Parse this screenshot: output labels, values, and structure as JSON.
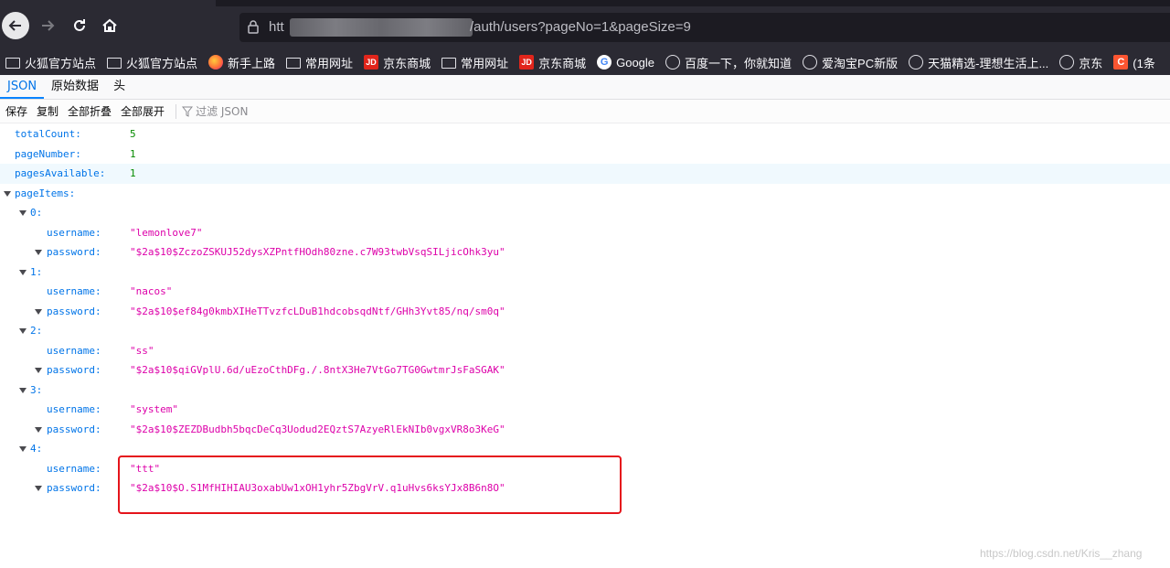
{
  "browser": {
    "url_prefix": "htt",
    "url_suffix": "/auth/users?pageNo=1&pageSize=9",
    "bookmarks": [
      {
        "label": "火狐官方站点",
        "icon": "folder-icon"
      },
      {
        "label": "火狐官方站点",
        "icon": "folder-icon"
      },
      {
        "label": "新手上路",
        "icon": "firefox-icon"
      },
      {
        "label": "常用网址",
        "icon": "folder-icon"
      },
      {
        "label": "京东商城",
        "icon": "jd-icon"
      },
      {
        "label": "常用网址",
        "icon": "folder-icon"
      },
      {
        "label": "京东商城",
        "icon": "jd-icon"
      },
      {
        "label": "Google",
        "icon": "google-icon"
      },
      {
        "label": "百度一下，你就知道",
        "icon": "globe-icon"
      },
      {
        "label": "爱淘宝PC新版",
        "icon": "globe-icon"
      },
      {
        "label": "天猫精选-理想生活上...",
        "icon": "globe-icon"
      },
      {
        "label": "京东",
        "icon": "globe-icon"
      },
      {
        "label": "(1条",
        "icon": "csdn-icon"
      }
    ]
  },
  "viewer": {
    "tabs": [
      "JSON",
      "原始数据",
      "头"
    ],
    "active_tab": "JSON",
    "toolbar": {
      "save": "保存",
      "copy": "复制",
      "collapse_all": "全部折叠",
      "expand_all": "全部展开",
      "filter_placeholder": "过滤 JSON"
    }
  },
  "json": {
    "totalCount": {
      "key": "totalCount:",
      "value": "5"
    },
    "pageNumber": {
      "key": "pageNumber:",
      "value": "1"
    },
    "pagesAvailable": {
      "key": "pagesAvailable:",
      "value": "1"
    },
    "pageItems_key": "pageItems:",
    "username_key": "username:",
    "password_key": "password:",
    "items": [
      {
        "index": "0:",
        "username": "\"lemonlove7\"",
        "password": "\"$2a$10$ZczoZSKUJ52dysXZPntfHOdh80zne.c7W93twbVsqSILjicOhk3yu\""
      },
      {
        "index": "1:",
        "username": "\"nacos\"",
        "password": "\"$2a$10$ef84g0kmbXIHeTTvzfcLDuB1hdcobsqdNtf/GHh3Yvt85/nq/sm0q\""
      },
      {
        "index": "2:",
        "username": "\"ss\"",
        "password": "\"$2a$10$qiGVplU.6d/uEzoCthDFg./.8ntX3He7VtGo7TG0GwtmrJsFaSGAK\""
      },
      {
        "index": "3:",
        "username": "\"system\"",
        "password": "\"$2a$10$ZEZDBudbh5bqcDeCq3Uodud2EQztS7AzyeRlEkNIb0vgxVR8o3KeG\""
      },
      {
        "index": "4:",
        "username": "\"ttt\"",
        "password": "\"$2a$10$O.S1MfHIHIAU3oxabUw1xOH1yhr5ZbgVrV.q1uHvs6ksYJx8B6n8O\""
      }
    ]
  },
  "watermark": "https://blog.csdn.net/Kris__zhang"
}
